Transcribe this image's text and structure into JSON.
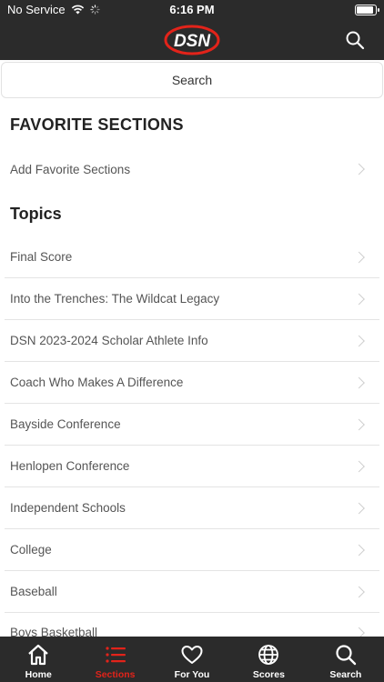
{
  "status_bar": {
    "carrier": "No Service",
    "time": "6:16 PM"
  },
  "header": {
    "logo_text": "DSN",
    "search_icon": "search-icon"
  },
  "search": {
    "label": "Search"
  },
  "favorites": {
    "heading": "FAVORITE SECTIONS",
    "items": [
      {
        "label": "Add Favorite Sections"
      }
    ]
  },
  "topics": {
    "heading": "Topics",
    "items": [
      {
        "label": "Final Score"
      },
      {
        "label": "Into the Trenches: The Wildcat Legacy"
      },
      {
        "label": "DSN 2023-2024 Scholar Athlete Info"
      },
      {
        "label": "Coach Who Makes A Difference"
      },
      {
        "label": "Bayside Conference"
      },
      {
        "label": "Henlopen Conference"
      },
      {
        "label": "Independent Schools"
      },
      {
        "label": "College"
      },
      {
        "label": "Baseball"
      },
      {
        "label": "Boys Basketball"
      }
    ]
  },
  "tab_bar": {
    "tabs": [
      {
        "label": "Home",
        "icon": "home-icon"
      },
      {
        "label": "Sections",
        "icon": "list-icon",
        "active": true
      },
      {
        "label": "For You",
        "icon": "heart-icon"
      },
      {
        "label": "Scores",
        "icon": "globe-icon"
      },
      {
        "label": "Search",
        "icon": "search-icon"
      }
    ]
  },
  "colors": {
    "bar_background": "#2b2b2b",
    "accent": "#e2231a"
  }
}
